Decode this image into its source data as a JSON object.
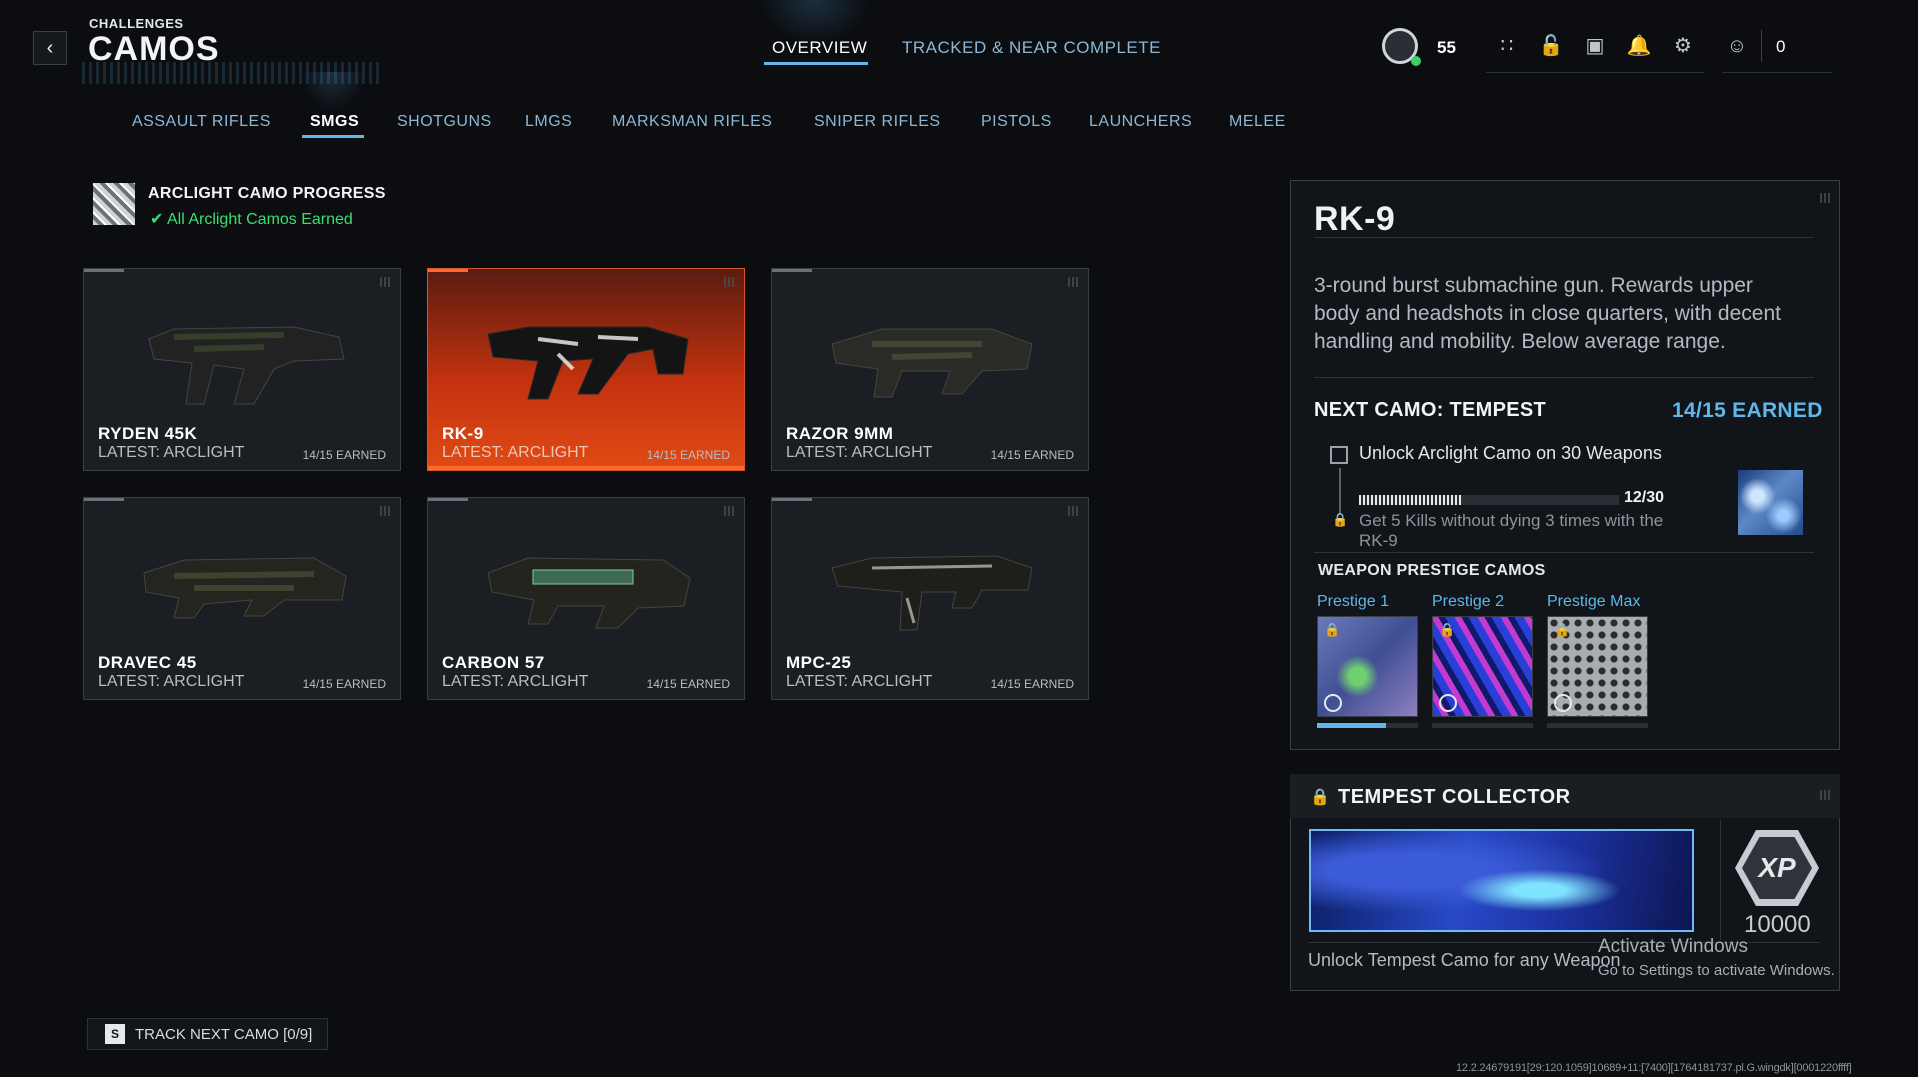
{
  "header": {
    "subtitle": "CHALLENGES",
    "title": "CAMOS"
  },
  "top_tabs": [
    {
      "label": "OVERVIEW",
      "active": true
    },
    {
      "label": "TRACKED & NEAR COMPLETE",
      "active": false
    }
  ],
  "status": {
    "level": "55",
    "friends_count": "0",
    "icons": [
      "grid-icon",
      "unlock-icon",
      "camera-icon",
      "bell-icon",
      "gear-icon",
      "friends-icon"
    ]
  },
  "category_tabs": [
    {
      "label": "ASSAULT RIFLES",
      "active": false
    },
    {
      "label": "SMGS",
      "active": true
    },
    {
      "label": "SHOTGUNS",
      "active": false
    },
    {
      "label": "LMGS",
      "active": false
    },
    {
      "label": "MARKSMAN RIFLES",
      "active": false
    },
    {
      "label": "SNIPER RIFLES",
      "active": false
    },
    {
      "label": "PISTOLS",
      "active": false
    },
    {
      "label": "LAUNCHERS",
      "active": false
    },
    {
      "label": "MELEE",
      "active": false
    }
  ],
  "arclight": {
    "title": "ARCLIGHT CAMO PROGRESS",
    "status": "All Arclight Camos Earned"
  },
  "weapons": [
    {
      "name": "RYDEN 45K",
      "latest": "LATEST: ARCLIGHT",
      "earned": "14/15 EARNED",
      "selected": false
    },
    {
      "name": "RK-9",
      "latest": "LATEST: ARCLIGHT",
      "earned": "14/15 EARNED",
      "selected": true
    },
    {
      "name": "RAZOR 9MM",
      "latest": "LATEST: ARCLIGHT",
      "earned": "14/15 EARNED",
      "selected": false
    },
    {
      "name": "DRAVEC 45",
      "latest": "LATEST: ARCLIGHT",
      "earned": "14/15 EARNED",
      "selected": false
    },
    {
      "name": "CARBON 57",
      "latest": "LATEST: ARCLIGHT",
      "earned": "14/15 EARNED",
      "selected": false
    },
    {
      "name": "MPC-25",
      "latest": "LATEST: ARCLIGHT",
      "earned": "14/15 EARNED",
      "selected": false
    }
  ],
  "track": {
    "key": "S",
    "label": "TRACK NEXT CAMO [0/9]"
  },
  "detail": {
    "name": "RK-9",
    "description": "3-round burst submachine gun. Rewards upper body and headshots in close quarters, with decent handling and mobility. Below average range.",
    "next_camo": "NEXT CAMO: TEMPEST",
    "earned": "14/15 EARNED",
    "challenge": {
      "label": "Unlock Arclight Camo on 30 Weapons",
      "progress": "12/30",
      "progress_fraction": 0.4,
      "next_desc": "Get 5 Kills without dying 3 times with the RK-9"
    },
    "prestige_title": "WEAPON PRESTIGE CAMOS",
    "prestige": [
      {
        "label": "Prestige 1",
        "progress_fraction": 0.68
      },
      {
        "label": "Prestige 2",
        "progress_fraction": 0
      },
      {
        "label": "Prestige Max",
        "progress_fraction": 0
      }
    ]
  },
  "collector": {
    "title": "TEMPEST COLLECTOR",
    "xp_badge": "XP",
    "xp_value": "10000",
    "description": "Unlock Tempest Camo for any Weapon"
  },
  "windows_notice": {
    "title": "Activate Windows",
    "subtitle": "Go to Settings to activate Windows."
  },
  "build_string": "12.2.24679191[29:120.1059]10689+11:[7400][1764181737.pl.G.wingdk][0001220ffff]",
  "colors": {
    "accent": "#5fb7ea",
    "selected_card": "#c2320f",
    "success": "#38e06a"
  }
}
